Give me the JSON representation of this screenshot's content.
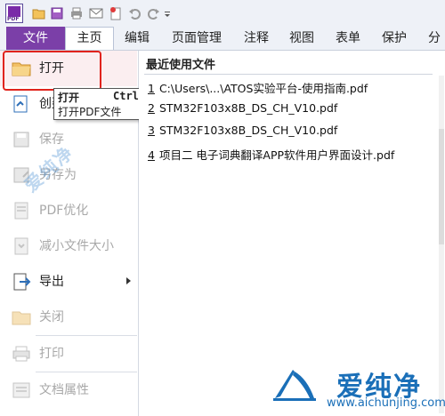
{
  "quick_access": {
    "icons": [
      "app-logo-icon",
      "open-folder-icon",
      "save-icon",
      "print-icon",
      "email-icon",
      "new-doc-icon",
      "undo-icon",
      "redo-icon",
      "customize-arrow-icon"
    ],
    "app_logo_text": "PDF"
  },
  "menubar": {
    "file_tab": "文件",
    "tabs": [
      "主页",
      "编辑",
      "页面管理",
      "注释",
      "视图",
      "表单",
      "保护",
      "分享"
    ]
  },
  "file_menu": {
    "items": [
      {
        "label": "打开",
        "icon": "folder-open-icon",
        "enabled": true
      },
      {
        "label": "创建",
        "icon": "create-pdf-icon",
        "enabled": true
      },
      {
        "label": "保存",
        "icon": "save-icon",
        "enabled": false
      },
      {
        "label": "另存为",
        "icon": "save-as-icon",
        "enabled": false
      },
      {
        "label": "PDF优化",
        "icon": "pdf-optimize-icon",
        "enabled": false
      },
      {
        "label": "减小文件大小",
        "icon": "reduce-size-icon",
        "enabled": false
      },
      {
        "label": "导出",
        "icon": "export-icon",
        "enabled": true
      },
      {
        "label": "关闭",
        "icon": "close-folder-icon",
        "enabled": false
      },
      {
        "label": "打印",
        "icon": "print-icon",
        "enabled": false
      },
      {
        "label": "文档属性",
        "icon": "doc-properties-icon",
        "enabled": false
      }
    ]
  },
  "tooltip": {
    "title": "打开",
    "shortcut": "Ctrl+O",
    "description": "打开PDF文件"
  },
  "recent": {
    "title": "最近使用文件",
    "files": [
      {
        "num": "1",
        "name": "C:\\Users\\...\\ATOS实验平台-使用指南.pdf"
      },
      {
        "num": "2",
        "name": "STM32F103x8B_DS_CH_V10.pdf"
      },
      {
        "num": "3",
        "name": "STM32F103x8B_DS_CH_V10.pdf"
      },
      {
        "num": "4",
        "name": "项目二 电子词典翻译APP软件用户界面设计.pdf"
      }
    ]
  },
  "watermark": {
    "brand": "爱纯净",
    "url": "www.aichunjing.com",
    "diagonal": "爱纯净"
  },
  "colors": {
    "file_tab_bg": "#7b3fa8",
    "highlight_border": "#e0231d",
    "watermark_blue": "#1a6fb8"
  }
}
